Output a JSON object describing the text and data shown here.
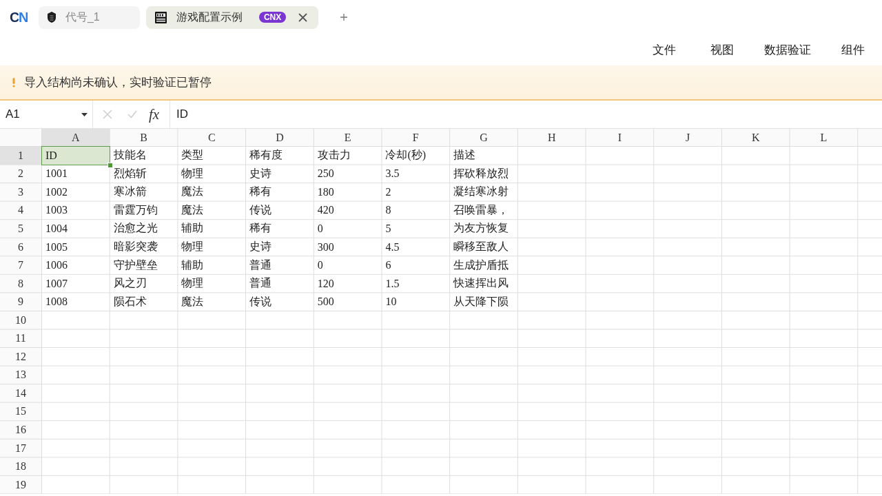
{
  "app": {
    "logo": "CN"
  },
  "tabs": [
    {
      "label": "代号_1",
      "selected": false,
      "closable": false
    },
    {
      "label": "游戏配置示例",
      "badge": "CNX",
      "selected": true,
      "closable": true
    }
  ],
  "menu": [
    "文件",
    "视图",
    "数据验证",
    "组件"
  ],
  "banner": {
    "message": "导入结构尚未确认，实时验证已暂停"
  },
  "formula_bar": {
    "name_box": "A1",
    "function_label": "fx",
    "content": "ID",
    "actions_disabled": true
  },
  "sheet": {
    "columns": [
      {
        "label": "A",
        "selected": true
      },
      {
        "label": "B",
        "selected": false
      },
      {
        "label": "C",
        "selected": false
      },
      {
        "label": "D",
        "selected": false
      },
      {
        "label": "E",
        "selected": false
      },
      {
        "label": "F",
        "selected": false
      },
      {
        "label": "G",
        "selected": false
      },
      {
        "label": "H",
        "selected": false
      },
      {
        "label": "I",
        "selected": false
      },
      {
        "label": "J",
        "selected": false
      },
      {
        "label": "K",
        "selected": false
      },
      {
        "label": "L",
        "selected": false
      }
    ],
    "rows": [
      {
        "number": "1",
        "selected": true,
        "cells": [
          "ID",
          "技能名",
          "类型",
          "稀有度",
          "攻击力",
          "冷却(秒)",
          "描述"
        ]
      },
      {
        "number": "2",
        "selected": false,
        "cells": [
          "1001",
          "烈焰斩",
          "物理",
          "史诗",
          "250",
          "3.5",
          "挥砍释放烈"
        ]
      },
      {
        "number": "3",
        "selected": false,
        "cells": [
          "1002",
          "寒冰箭",
          "魔法",
          "稀有",
          "180",
          "2",
          "凝结寒冰射"
        ]
      },
      {
        "number": "4",
        "selected": false,
        "cells": [
          "1003",
          "雷霆万钧",
          "魔法",
          "传说",
          "420",
          "8",
          "召唤雷暴，"
        ]
      },
      {
        "number": "5",
        "selected": false,
        "cells": [
          "1004",
          "治愈之光",
          "辅助",
          "稀有",
          "0",
          "5",
          "为友方恢复"
        ]
      },
      {
        "number": "6",
        "selected": false,
        "cells": [
          "1005",
          "暗影突袭",
          "物理",
          "史诗",
          "300",
          "4.5",
          "瞬移至敌人"
        ]
      },
      {
        "number": "7",
        "selected": false,
        "cells": [
          "1006",
          "守护壁垒",
          "辅助",
          "普通",
          "0",
          "6",
          "生成护盾抵"
        ]
      },
      {
        "number": "8",
        "selected": false,
        "cells": [
          "1007",
          "风之刃",
          "物理",
          "普通",
          "120",
          "1.5",
          "快速挥出风"
        ]
      },
      {
        "number": "9",
        "selected": false,
        "cells": [
          "1008",
          "陨石术",
          "魔法",
          "传说",
          "500",
          "10",
          "从天降下陨"
        ]
      },
      {
        "number": "10",
        "selected": false
      },
      {
        "number": "11",
        "selected": false
      },
      {
        "number": "12",
        "selected": false
      },
      {
        "number": "13",
        "selected": false
      },
      {
        "number": "14",
        "selected": false
      },
      {
        "number": "15",
        "selected": false
      },
      {
        "number": "16",
        "selected": false
      },
      {
        "number": "17",
        "selected": false
      },
      {
        "number": "18",
        "selected": false
      },
      {
        "number": "19",
        "selected": false
      }
    ]
  }
}
